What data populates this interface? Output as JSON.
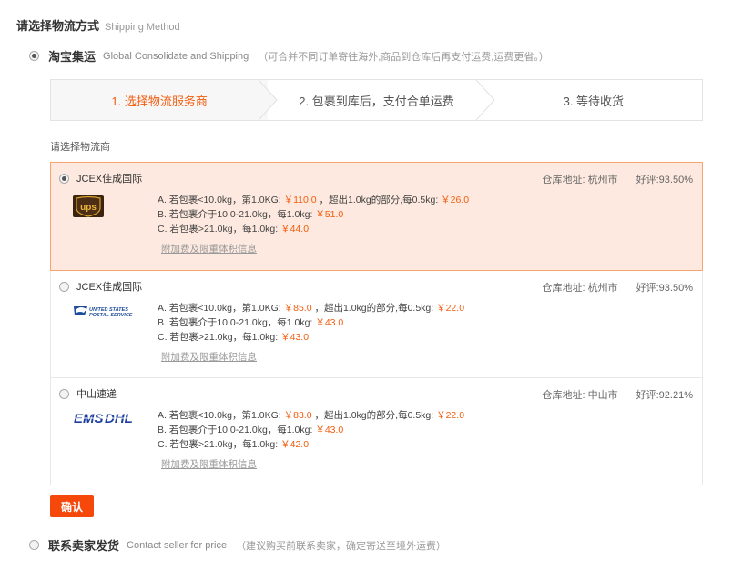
{
  "section": {
    "title": "请选择物流方式",
    "title_en": "Shipping Method"
  },
  "methods": [
    {
      "name": "淘宝集运",
      "en": "Global Consolidate and Shipping",
      "note": "（可合并不同订单寄往海外,商品到仓库后再支付运费,运费更省。）",
      "checked": true
    },
    {
      "name": "联系卖家发货",
      "en": "Contact seller for price",
      "note": "（建议购买前联系卖家，确定寄送至境外运费）",
      "checked": false
    }
  ],
  "steps": [
    {
      "label": "1. 选择物流服务商",
      "active": true
    },
    {
      "label": "2. 包裹到库后，支付合单运费",
      "active": false
    },
    {
      "label": "3. 等待收货",
      "active": false
    }
  ],
  "list_label": "请选择物流商",
  "carriers": [
    {
      "name": "JCEX佳成国际",
      "logo": "ups-logo",
      "warehouse": "仓库地址: 杭州市",
      "rating": "好评:93.50%",
      "selected": true,
      "rates": [
        {
          "text": "A. 若包裹<10.0kg，第1.0KG: ",
          "p1": "￥110.0",
          "mid": " ，超出1.0kg的部分,每0.5kg: ",
          "p2": "￥26.0"
        },
        {
          "text": "B. 若包裹介于10.0-21.0kg，每1.0kg: ",
          "p1": "￥51.0",
          "mid": "",
          "p2": ""
        },
        {
          "text": "C. 若包裹>21.0kg，每1.0kg: ",
          "p1": "￥44.0",
          "mid": "",
          "p2": ""
        }
      ],
      "link": "附加费及限重体积信息"
    },
    {
      "name": "JCEX佳成国际",
      "logo": "usps-logo",
      "warehouse": "仓库地址: 杭州市",
      "rating": "好评:93.50%",
      "selected": false,
      "rates": [
        {
          "text": "A. 若包裹<10.0kg，第1.0KG: ",
          "p1": "￥85.0",
          "mid": " ，超出1.0kg的部分,每0.5kg: ",
          "p2": "￥22.0"
        },
        {
          "text": "B. 若包裹介于10.0-21.0kg，每1.0kg: ",
          "p1": "￥43.0",
          "mid": "",
          "p2": ""
        },
        {
          "text": "C. 若包裹>21.0kg，每1.0kg: ",
          "p1": "￥43.0",
          "mid": "",
          "p2": ""
        }
      ],
      "link": "附加费及限重体积信息",
      "logo_text": [
        "UNITED STATES",
        "POSTAL SERVICE"
      ]
    },
    {
      "name": "中山速递",
      "logo": "ems-dhl-logo",
      "warehouse": "仓库地址: 中山市",
      "rating": "好评:92.21%",
      "selected": false,
      "rates": [
        {
          "text": "A. 若包裹<10.0kg，第1.0KG: ",
          "p1": "￥83.0",
          "mid": " ，超出1.0kg的部分,每0.5kg: ",
          "p2": "￥22.0"
        },
        {
          "text": "B. 若包裹介于10.0-21.0kg，每1.0kg: ",
          "p1": "￥43.0",
          "mid": "",
          "p2": ""
        },
        {
          "text": "C. 若包裹>21.0kg，每1.0kg: ",
          "p1": "￥42.0",
          "mid": "",
          "p2": ""
        }
      ],
      "link": "附加费及限重体积信息",
      "logo_text": [
        "EMS",
        "DHL"
      ]
    }
  ],
  "confirm_label": "确认",
  "colors": {
    "accent": "#f25d0f",
    "selected_bg": "#fde9df",
    "selected_border": "#f7a46f",
    "button": "#f5480a"
  }
}
